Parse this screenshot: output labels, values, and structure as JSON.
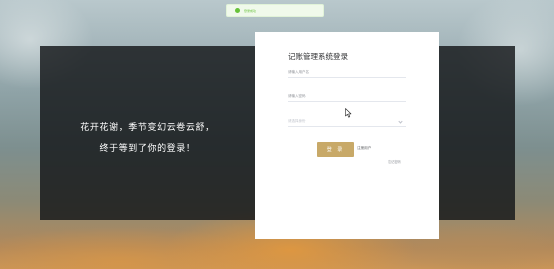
{
  "toast": {
    "icon": "success-icon",
    "text": "登录成功"
  },
  "slogan": {
    "line1": "花开花谢，季节变幻云卷云舒，",
    "line2": "终于等到了你的登录！"
  },
  "login": {
    "title": "记账管理系统登录",
    "username_placeholder": "请输入用户名",
    "password_placeholder": "请输入密码",
    "role_placeholder": "请选择身份",
    "login_button": "登 录",
    "register_link": "注册用户",
    "forgot_link": "忘记密码"
  },
  "colors": {
    "accent_gold": "#c8a968",
    "success_green": "#67c23a"
  }
}
